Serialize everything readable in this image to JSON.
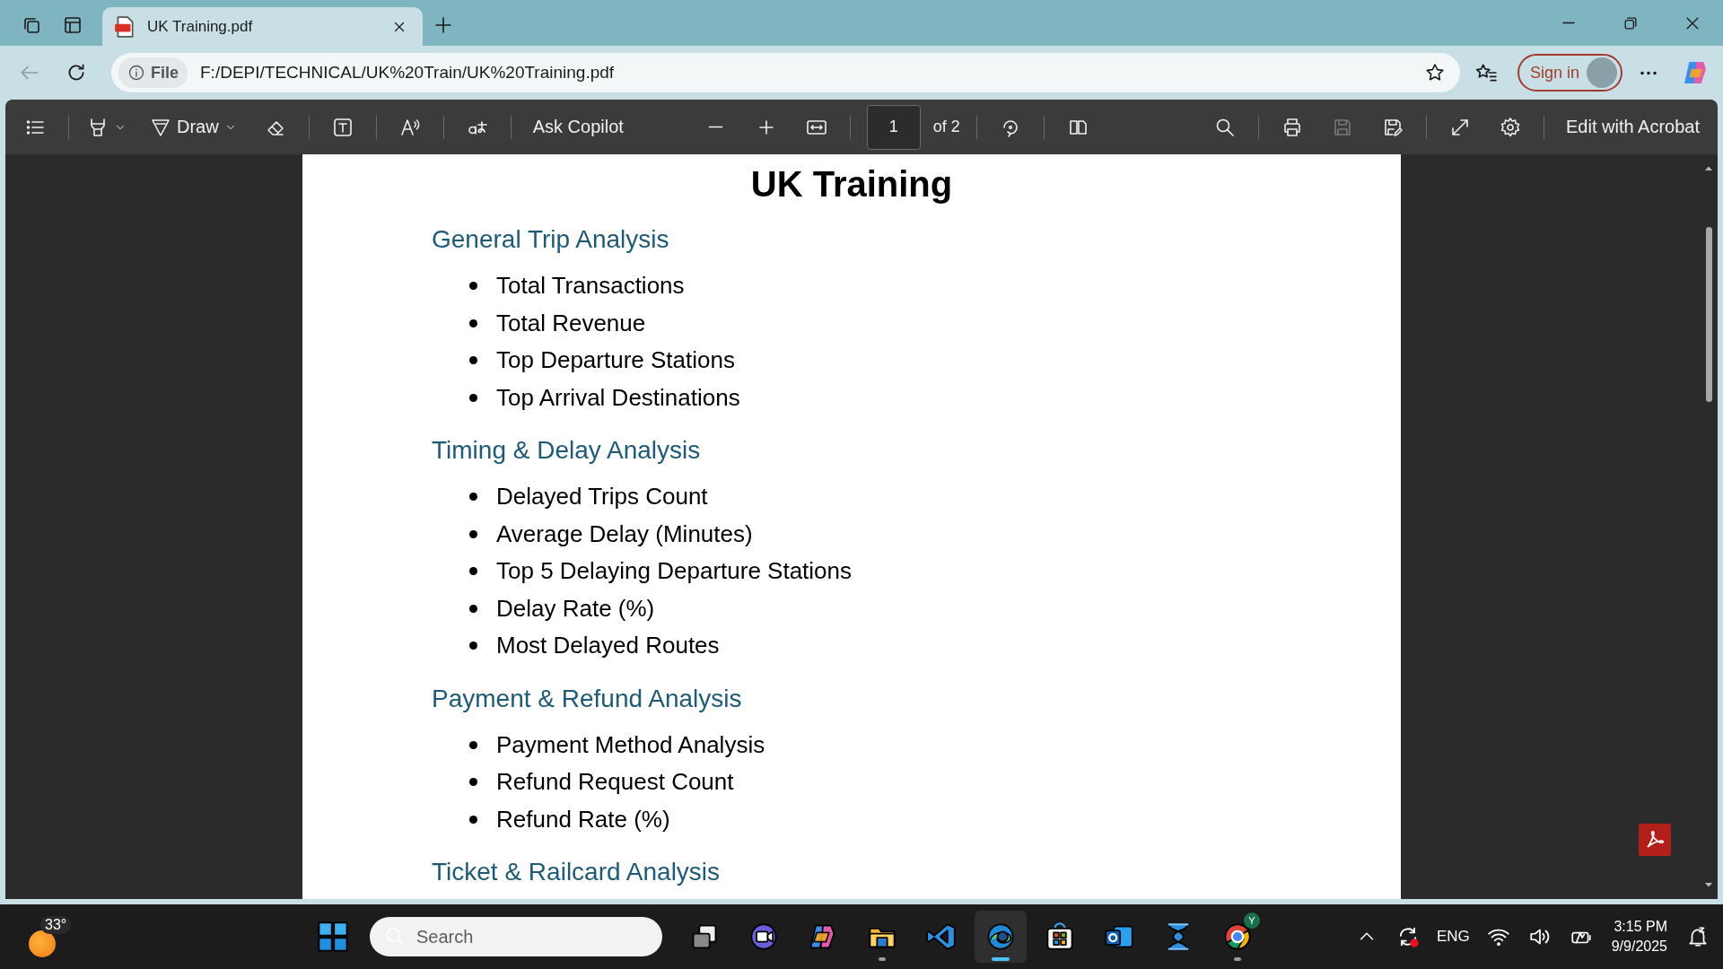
{
  "browser": {
    "tabs": [
      {
        "title": "UK Training.pdf",
        "selected": true
      }
    ],
    "address": {
      "scheme_label": "File",
      "url": "F:/DEPI/TECHNICAL/UK%20Train/UK%20Training.pdf"
    },
    "sign_in": "Sign in"
  },
  "pdf_toolbar": {
    "left_groups": [
      [
        {
          "kind": "toc",
          "disabled": false
        }
      ],
      [
        {
          "kind": "highlight",
          "disabled": false
        },
        {
          "kind": "draw",
          "label": "Draw",
          "disabled": false
        },
        {
          "kind": "eraser",
          "disabled": false
        }
      ],
      [
        {
          "kind": "textbox",
          "disabled": false
        }
      ],
      [
        {
          "kind": "read-aloud",
          "disabled": false
        }
      ],
      [
        {
          "kind": "translate",
          "disabled": false
        }
      ],
      [
        {
          "kind": "copilot",
          "label": "Ask Copilot",
          "disabled": false
        },
        {
          "kind": "zoom-out",
          "disabled": false
        },
        {
          "kind": "zoom-in",
          "disabled": false
        },
        {
          "kind": "fit-width",
          "disabled": false
        }
      ],
      [
        {
          "kind": "page",
          "value": "1",
          "total": "of 2",
          "disabled": false
        }
      ],
      [
        {
          "kind": "rotate",
          "disabled": false
        }
      ],
      [
        {
          "kind": "page-view",
          "disabled": false
        }
      ]
    ],
    "right_groups": [
      [
        {
          "kind": "search",
          "disabled": false
        }
      ],
      [
        {
          "kind": "print",
          "disabled": false
        },
        {
          "kind": "save",
          "disabled": true
        },
        {
          "kind": "save-as",
          "disabled": false
        }
      ],
      [
        {
          "kind": "fullscreen",
          "disabled": false
        },
        {
          "kind": "settings",
          "disabled": false
        }
      ],
      [
        {
          "kind": "acrobat",
          "label": "Edit with Acrobat",
          "disabled": false
        }
      ]
    ]
  },
  "document": {
    "title": "UK Training",
    "sections": [
      {
        "heading": "General Trip Analysis",
        "items": [
          "Total Transactions",
          "Total Revenue",
          "Top Departure Stations",
          "Top Arrival Destinations"
        ]
      },
      {
        "heading": "Timing & Delay Analysis",
        "items": [
          "Delayed Trips Count",
          "Average Delay (Minutes)",
          "Top 5 Delaying Departure Stations",
          "Delay Rate (%)",
          "Most Delayed Routes"
        ]
      },
      {
        "heading": "Payment & Refund Analysis",
        "items": [
          "Payment Method Analysis",
          "Refund Request Count",
          "Refund Rate (%)"
        ]
      },
      {
        "heading": "Ticket & Railcard Analysis"
      }
    ]
  },
  "taskbar": {
    "weather": "33°",
    "search_placeholder": "Search",
    "apps": [
      {
        "kind": "task-view",
        "selected": false,
        "running": false
      },
      {
        "kind": "chat",
        "selected": false,
        "running": false
      },
      {
        "kind": "copilot",
        "selected": false,
        "running": false
      },
      {
        "kind": "folder",
        "selected": false,
        "running": true
      },
      {
        "kind": "code",
        "selected": false,
        "running": false
      },
      {
        "kind": "edge",
        "selected": true,
        "running": true
      },
      {
        "kind": "store",
        "selected": false,
        "running": false
      },
      {
        "kind": "mail",
        "selected": false,
        "running": false
      },
      {
        "kind": "ribbon",
        "selected": false,
        "running": false
      },
      {
        "kind": "chrome",
        "selected": false,
        "running": true,
        "badge": "Y"
      }
    ],
    "language": "ENG",
    "time": "3:15 PM",
    "date": "9/9/2025"
  }
}
